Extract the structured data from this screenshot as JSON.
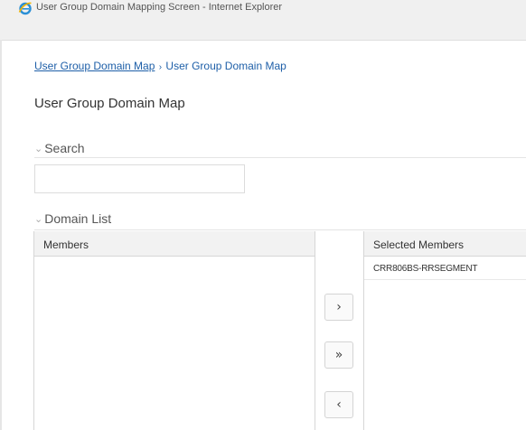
{
  "window": {
    "title": "User Group Domain Mapping Screen - Internet Explorer",
    "icon": "ie-icon"
  },
  "breadcrumb": {
    "items": [
      "User Group Domain Map",
      "User Group Domain Map"
    ],
    "separator": "›"
  },
  "page": {
    "title": "User Group Domain Map"
  },
  "search": {
    "header": "Search",
    "input_value": "",
    "input_placeholder": ""
  },
  "domain_list": {
    "header": "Domain List",
    "members": {
      "header": "Members",
      "items": []
    },
    "selected_members": {
      "header": "Selected Members",
      "items": [
        "CRR806BS-RRSEGMENT"
      ]
    },
    "buttons": {
      "move": "›",
      "move_all": "»",
      "remove": "‹"
    }
  },
  "colors": {
    "link": "#1e5fa8",
    "titlebar": "#f0f0f0",
    "panel_header": "#f2f2f2",
    "border": "#d6d6d6"
  }
}
